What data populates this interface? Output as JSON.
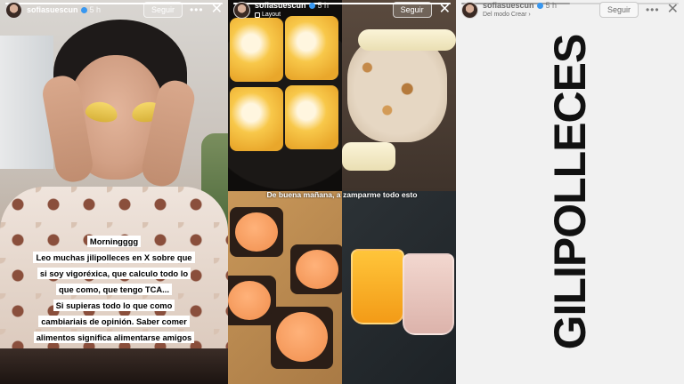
{
  "story1": {
    "username": "sofiasuescun",
    "time": "5 h",
    "follow_label": "Seguir",
    "progress": 1.0,
    "caption_lines": [
      "Morningggg",
      "Leo muchas jilipolleces en X sobre que",
      "si soy vigoréxica, que calculo todo lo",
      "que como, que tengo TCA...",
      "Si supieras todo lo que como",
      "cambiariais de opinión. Saber comer",
      "alimentos significa alimentarse amigos"
    ]
  },
  "story2": {
    "username": "sofiasuescun",
    "time": "5 h",
    "subtitle": "Layout",
    "follow_label": "Seguir",
    "progress": 1.0,
    "caption": "De buena mañana, a zamparme todo esto"
  },
  "story3": {
    "username": "sofiasuescun",
    "time": "5 h",
    "subtitle": "Del modo Crear",
    "follow_label": "Seguir",
    "progress": 0.5,
    "big_text": "GILIPOLLECES"
  },
  "icons": {
    "more": "more-horizontal-icon",
    "close": "close-icon",
    "verified": "verified-badge-icon"
  }
}
